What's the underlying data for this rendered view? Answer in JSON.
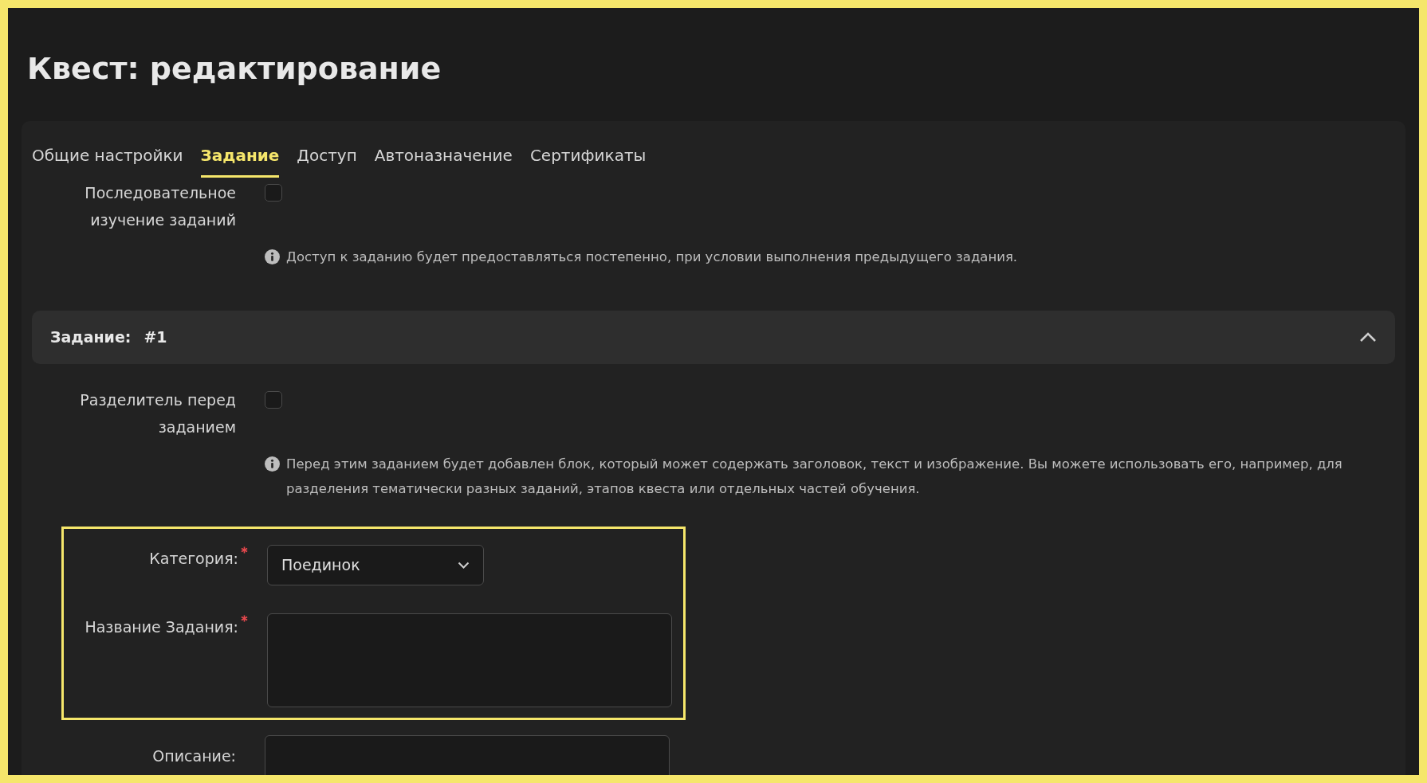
{
  "page": {
    "title": "Квест: редактирование"
  },
  "tabs": [
    {
      "label": "Общие настройки",
      "selected": false
    },
    {
      "label": "Задание",
      "selected": true
    },
    {
      "label": "Доступ",
      "selected": false
    },
    {
      "label": "Автоназначение",
      "selected": false
    },
    {
      "label": "Сертификаты",
      "selected": false
    }
  ],
  "sequential": {
    "label": "Последовательное изучение заданий",
    "checked": false,
    "hint": "Доступ к заданию будет предоставляться постепенно, при условии выполнения предыдущего задания."
  },
  "task": {
    "title": "Задание:",
    "number": "#1",
    "expanded": true,
    "separator": {
      "label": "Разделитель перед заданием",
      "checked": false,
      "hint": "Перед этим заданием будет добавлен блок, который может содержать заголовок, текст и изображение. Вы можете использовать его, например, для разделения тематически разных заданий, этапов квеста или отдельных частей обучения."
    },
    "category": {
      "label": "Категория:",
      "required": true,
      "value": "Поединок"
    },
    "name": {
      "label": "Название Задания:",
      "required": true
    },
    "description": {
      "label": "Описание:",
      "required": false
    }
  }
}
